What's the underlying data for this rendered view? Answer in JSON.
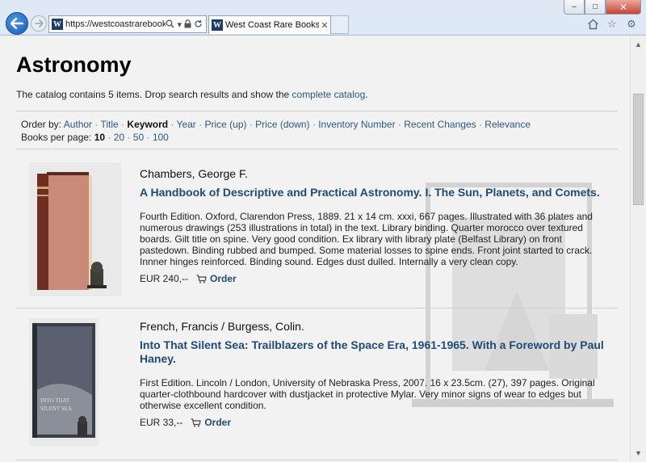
{
  "browser": {
    "url": "https://westcoastrarebooks....",
    "tab_title": "West Coast Rare Books: Ast...",
    "favicon_letter": "W",
    "icons": [
      "back-arrow-icon",
      "forward-arrow-icon",
      "search-icon",
      "lock-icon",
      "refresh-icon",
      "home-icon",
      "favorites-star-icon",
      "settings-gear-icon"
    ],
    "window_controls": {
      "minimize": "–",
      "maximize": "□",
      "close": "✕"
    }
  },
  "page": {
    "heading": "Astronomy",
    "intro_text": "The catalog contains 5 items. Drop search results and show the ",
    "intro_link": "complete catalog",
    "intro_end": ".",
    "order_by_label": "Order by: ",
    "sort_options": [
      {
        "label": "Author",
        "current": false
      },
      {
        "label": "Title",
        "current": false
      },
      {
        "label": "Keyword",
        "current": true
      },
      {
        "label": "Year",
        "current": false
      },
      {
        "label": "Price (up)",
        "current": false
      },
      {
        "label": "Price (down)",
        "current": false
      },
      {
        "label": "Inventory Number",
        "current": false
      },
      {
        "label": "Recent Changes",
        "current": false
      },
      {
        "label": "Relevance",
        "current": false
      }
    ],
    "per_page_label": "Books per page: ",
    "per_page_options": [
      {
        "label": "10",
        "current": true
      },
      {
        "label": "20",
        "current": false
      },
      {
        "label": "50",
        "current": false
      },
      {
        "label": "100",
        "current": false
      }
    ],
    "separator": " · ",
    "order_label": "Order",
    "items": [
      {
        "author": "Chambers, George F.",
        "title": "A Handbook of Descriptive and Practical Astronomy. I. The Sun, Planets, and Comets.",
        "description": "Fourth Edition. Oxford, Clarendon Press, 1889. 21 x 14 cm. xxxi, 667 pages. Illustrated with 36 plates and numerous drawings (253 illustrations in total) in the text. Library binding. Quarter morocco over textured boards. Gilt title on spine. Very good condition. Ex library with library plate (Belfast Library) on front pastedown. Binding rubbed and bumped. Some material losses to spine ends. Front joint started to crack. Innner hinges reinforced. Binding sound. Edges dust dulled. Internally a very clean copy.",
        "price": "EUR 240,--"
      },
      {
        "author": "French, Francis / Burgess, Colin.",
        "title": "Into That Silent Sea: Trailblazers of the Space Era, 1961-1965. With a Foreword by Paul Haney.",
        "description": "First Edition. Lincoln / London, University of Nebraska Press, 2007. 16 x 23.5cm. (27), 397 pages. Original quarter-clothbound hardcover with dustjacket in protective Mylar. Very minor signs of wear to edges but otherwise excellent condition.",
        "price": "EUR 33,--"
      }
    ]
  }
}
